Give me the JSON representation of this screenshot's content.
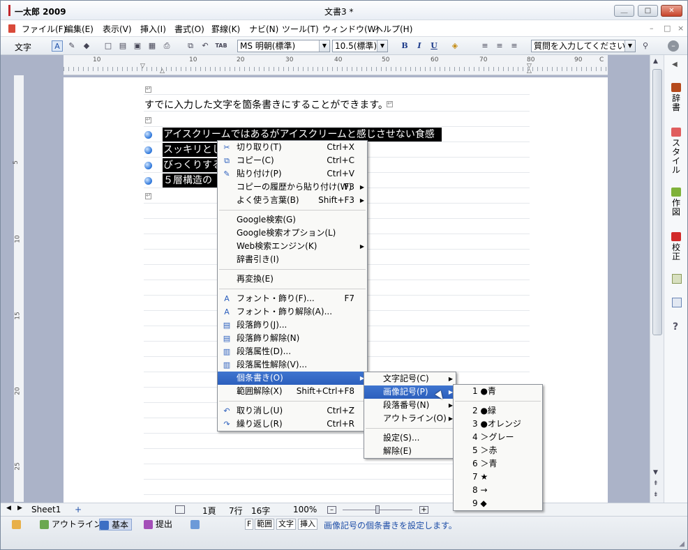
{
  "app": {
    "title": "一太郎 2009",
    "document_title": "文書3 *"
  },
  "window_buttons": {
    "minimize": "＿",
    "maximize": "□",
    "close": "✕"
  },
  "menubar": {
    "items": [
      "ファイル(F)",
      "編集(E)",
      "表示(V)",
      "挿入(I)",
      "書式(O)",
      "罫線(K)",
      "ナビ(N)",
      "ツール(T)",
      "ウィンドウ(W)",
      "ヘルプ(H)"
    ],
    "doc_controls": [
      "–",
      "□",
      "×"
    ]
  },
  "toolbar": {
    "mode_label": "文字",
    "font_name": "MS 明朝(標準)",
    "font_size": "10.5(標準)",
    "bold": "B",
    "italic": "I",
    "underline": "U",
    "question_placeholder": "質問を入力してください"
  },
  "ruler": {
    "numbers": [
      "10",
      "10",
      "20",
      "30",
      "40",
      "50",
      "60",
      "70",
      "80",
      "90"
    ],
    "end_label": "C"
  },
  "vruler": {
    "numbers": [
      "5",
      "10",
      "15",
      "20",
      "25"
    ]
  },
  "document": {
    "intro": "すでに入力した文字を箇条書きにすることができます。",
    "bullet_lines": [
      "アイスクリームではあるがアイスクリームと感じさせない食感",
      "スッキリとした",
      "びっくりする",
      "５層構造の"
    ]
  },
  "context_menu": {
    "items": [
      {
        "label": "切り取り(T)",
        "shortcut": "Ctrl+X",
        "icon": "scissors-icon"
      },
      {
        "label": "コピー(C)",
        "shortcut": "Ctrl+C",
        "icon": "copy-icon"
      },
      {
        "label": "貼り付け(P)",
        "shortcut": "Ctrl+V",
        "icon": "paste-icon"
      },
      {
        "label": "コピーの履歴から貼り付け(W)",
        "shortcut": "F3",
        "arrow": true
      },
      {
        "label": "よく使う言葉(B)",
        "shortcut": "Shift+F3",
        "arrow": true
      },
      {
        "sep": true
      },
      {
        "label": "Google検索(G)"
      },
      {
        "label": "Google検索オプション(L)"
      },
      {
        "label": "Web検索エンジン(K)",
        "arrow": true
      },
      {
        "label": "辞書引き(I)"
      },
      {
        "sep": true
      },
      {
        "label": "再変換(E)"
      },
      {
        "sep": true
      },
      {
        "label": "フォント・飾り(F)...",
        "shortcut": "F7",
        "icon": "font-icon"
      },
      {
        "label": "フォント・飾り解除(A)...",
        "icon": "font-clear-icon"
      },
      {
        "label": "段落飾り(J)...",
        "icon": "paragraph-deco-icon"
      },
      {
        "label": "段落飾り解除(N)",
        "icon": "paragraph-deco-clear-icon"
      },
      {
        "label": "段落属性(D)...",
        "icon": "paragraph-attr-icon"
      },
      {
        "label": "段落属性解除(V)...",
        "icon": "paragraph-attr-clear-icon"
      },
      {
        "label": "個条書き(O)",
        "arrow": true,
        "highlighted": true
      },
      {
        "label": "範囲解除(X)",
        "shortcut": "Shift+Ctrl+F8"
      },
      {
        "sep": true
      },
      {
        "label": "取り消し(U)",
        "shortcut": "Ctrl+Z",
        "icon": "undo-icon"
      },
      {
        "label": "繰り返し(R)",
        "shortcut": "Ctrl+R",
        "icon": "redo-icon"
      }
    ]
  },
  "submenu_bullets": {
    "items": [
      {
        "label": "文字記号(C)",
        "arrow": true
      },
      {
        "label": "画像記号(P)",
        "arrow": true,
        "highlighted": true
      },
      {
        "label": "段落番号(N)",
        "arrow": true
      },
      {
        "label": "アウトライン(O)",
        "arrow": true
      },
      {
        "sep": true
      },
      {
        "label": "設定(S)..."
      },
      {
        "label": "解除(E)"
      }
    ]
  },
  "submenu_image_symbols": {
    "items": [
      {
        "label": "1 ●青"
      },
      {
        "sep": true
      },
      {
        "label": "2 ●緑"
      },
      {
        "label": "3 ●オレンジ"
      },
      {
        "label": "4 ＞グレー"
      },
      {
        "label": "5 ＞赤"
      },
      {
        "label": "6 ＞青"
      },
      {
        "label": "7 ★"
      },
      {
        "label": "8 →"
      },
      {
        "label": "9 ◆"
      }
    ]
  },
  "statusbar": {
    "sheet_tab": "Sheet1",
    "add_sheet": "+",
    "page": "1頁",
    "line": "7行",
    "col": "16字",
    "zoom": "100%"
  },
  "taskbar": {
    "outline": "アウトライン",
    "basic": "基本",
    "submit": "提出",
    "keys": [
      "F",
      "範囲",
      "文字",
      "挿入"
    ],
    "hint": "画像記号の個条書きを設定します。"
  },
  "sidepanel": {
    "items": [
      "辞書",
      "スタイル",
      "作図",
      "校正"
    ],
    "help": "?"
  },
  "colors": {
    "selection": "#000000",
    "menu_highlight": "#3169c6",
    "workspace": "#abb3c8"
  }
}
